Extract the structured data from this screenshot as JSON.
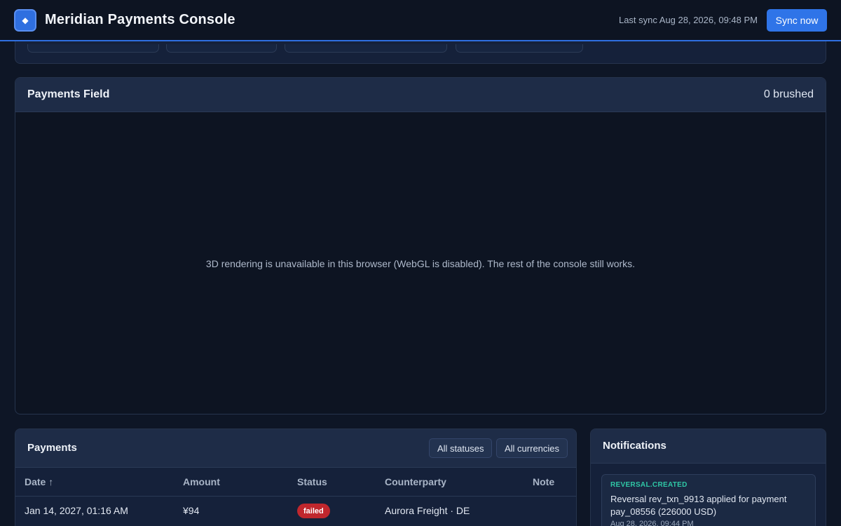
{
  "header": {
    "logo_icon": "diamond-icon",
    "logo_glyph": "◆",
    "title": "Meridian Payments Console",
    "last_sync": "Last sync Aug 28, 2026, 09:48 PM",
    "sync_button": "Sync now"
  },
  "field": {
    "title": "Payments Field",
    "brushed": "0 brushed",
    "message": "3D rendering is unavailable in this browser (WebGL is disabled). The rest of the console still works."
  },
  "payments": {
    "title": "Payments",
    "filters": [
      "All statuses",
      "All currencies"
    ],
    "columns": [
      "Date ↑",
      "Amount",
      "Status",
      "Counterparty",
      "Note"
    ],
    "rows": [
      {
        "date": "Jan 14, 2027, 01:16 AM",
        "amount": "¥94",
        "status": "failed",
        "counterparty": "Aurora Freight · DE",
        "note": ""
      }
    ]
  },
  "notifications": {
    "title": "Notifications",
    "items": [
      {
        "type": "REVERSAL.CREATED",
        "body": "Reversal rev_txn_9913 applied for payment pay_08556 (226000 USD)",
        "time": "Aug 28, 2026, 09:44 PM"
      }
    ]
  },
  "colors": {
    "accent": "#2f74e8",
    "status_failed": "#c0272d",
    "notification_type": "#2fc7a6",
    "background": "#0e1626"
  }
}
